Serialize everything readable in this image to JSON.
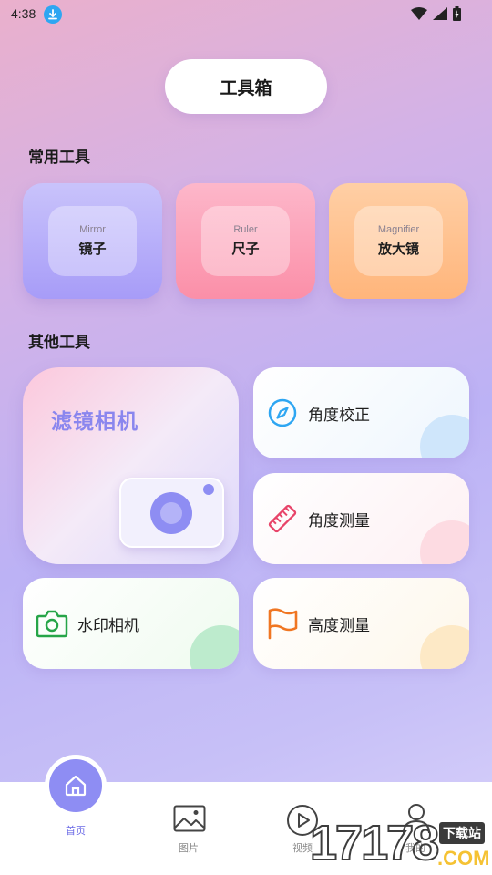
{
  "status_bar": {
    "time": "4:38"
  },
  "header": {
    "title": "工具箱"
  },
  "sections": {
    "common": "常用工具",
    "other": "其他工具"
  },
  "common_tools": [
    {
      "sub": "Mirror",
      "label": "镜子",
      "icon": "mirror"
    },
    {
      "sub": "Ruler",
      "label": "尺子",
      "icon": "ruler"
    },
    {
      "sub": "Magnifier",
      "label": "放大镜",
      "icon": "magnifier"
    }
  ],
  "filter_camera": {
    "label": "滤镜相机",
    "icon": "camera-icon"
  },
  "other_tools": {
    "angle_correct": {
      "label": "角度校正",
      "icon": "compass-icon",
      "color": "#2ea6f2"
    },
    "angle_measure": {
      "label": "角度测量",
      "icon": "ruler-icon",
      "color": "#e8456a"
    },
    "watermark_camera": {
      "label": "水印相机",
      "icon": "camera-icon",
      "color": "#26a548"
    },
    "height_measure": {
      "label": "高度测量",
      "icon": "flag-icon",
      "color": "#f07622"
    }
  },
  "bottom_nav": {
    "items": [
      {
        "label": "首页",
        "icon": "home-icon",
        "active": true
      },
      {
        "label": "图片",
        "icon": "image-icon",
        "active": false
      },
      {
        "label": "视频",
        "icon": "play-icon",
        "active": false
      },
      {
        "label": "我的",
        "icon": "user-icon",
        "active": false
      }
    ]
  },
  "watermark": {
    "digits": "17178",
    "box": "下载站",
    "com": ".COM"
  },
  "colors": {
    "accent": "#8e8df3"
  }
}
